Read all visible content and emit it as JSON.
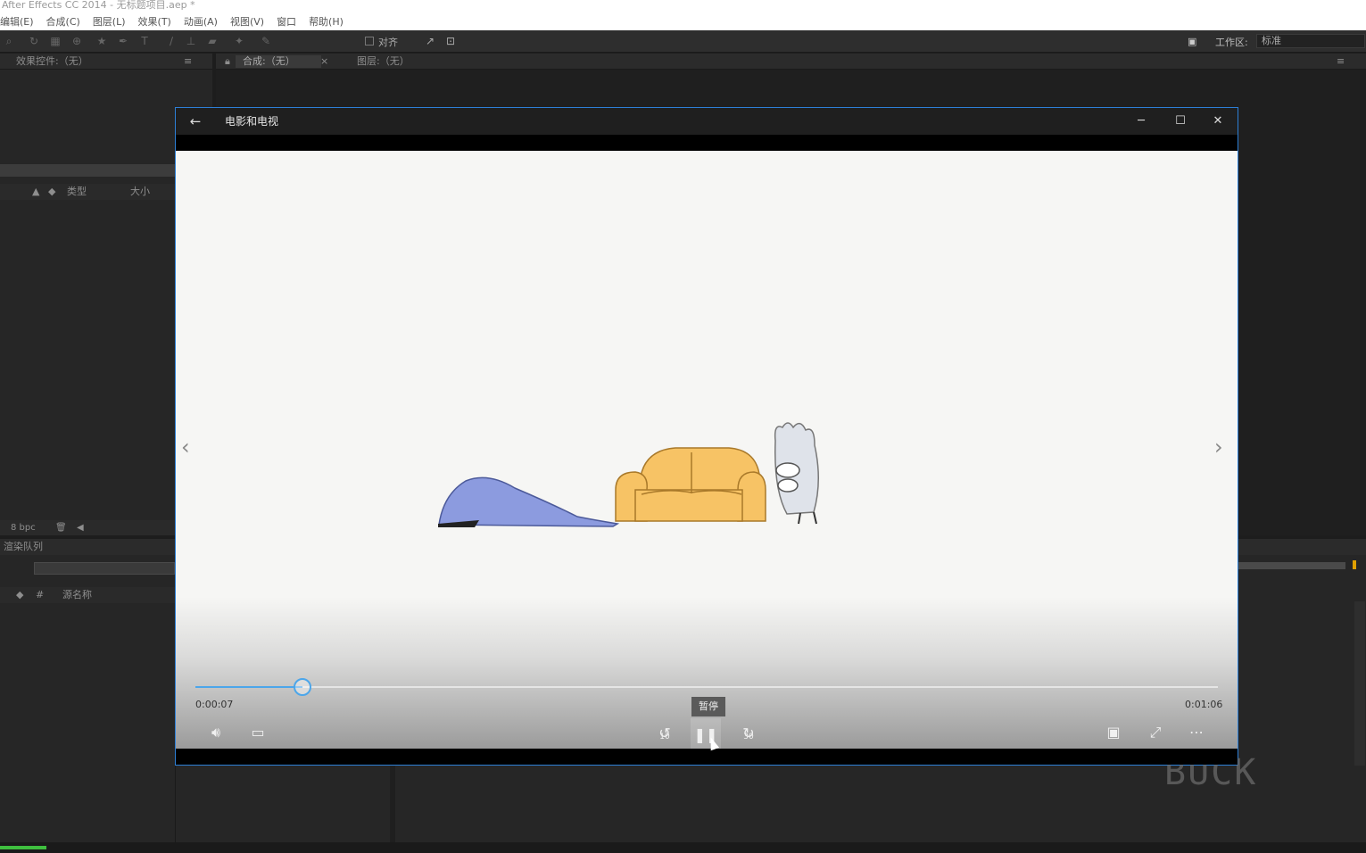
{
  "ae": {
    "title": "After Effects CC 2014 - 无标题项目.aep *",
    "menu": [
      "编辑(E)",
      "合成(C)",
      "图层(L)",
      "效果(T)",
      "动画(A)",
      "视图(V)",
      "窗口",
      "帮助(H)"
    ],
    "toolbar": {
      "snap_label": "对齐",
      "workspace_label": "工作区:",
      "workspace_value": "标准"
    },
    "panels": {
      "effects_tab": "效果控件:（无）",
      "comp_tab": "合成:（无）",
      "layer_tab": "图层:（无）",
      "project_col_type": "类型",
      "project_col_size": "大小",
      "bpc": "8 bpc",
      "render_queue": "渲染队列",
      "source_name": "源名称",
      "col_hash": "#"
    }
  },
  "player": {
    "title": "电影和电视",
    "current_time": "0:00:07",
    "total_time": "0:01:06",
    "progress": 0.105,
    "tooltip": "暂停",
    "rewind_seconds": "10",
    "forward_seconds": "30",
    "watermark": "BUCK",
    "accent_color": "#4ca6ea"
  }
}
